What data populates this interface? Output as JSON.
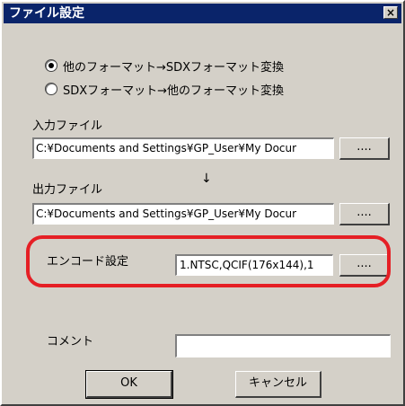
{
  "window": {
    "title": "ファイル設定",
    "close_label": "×"
  },
  "conversion": {
    "options": [
      {
        "label": "他のフォーマット→SDXフォーマット変換",
        "checked": true
      },
      {
        "label": "SDXフォーマット→他のフォーマット変換",
        "checked": false
      }
    ]
  },
  "input_file": {
    "label": "入力ファイル",
    "value": "C:¥Documents and Settings¥GP_User¥My Docur",
    "browse_label": "...."
  },
  "arrow": "↓",
  "output_file": {
    "label": "出力ファイル",
    "value": "C:¥Documents and Settings¥GP_User¥My Docur",
    "browse_label": "...."
  },
  "encode": {
    "label": "エンコード設定",
    "value": "1.NTSC,QCIF(176x144),1",
    "browse_label": "....",
    "highlight_color": "#e51f25"
  },
  "comment": {
    "label": "コメント",
    "value": ""
  },
  "buttons": {
    "ok": "OK",
    "cancel": "キャンセル"
  },
  "colors": {
    "titlebar": "#0a246a",
    "dialog_face": "#d4d0c8"
  }
}
